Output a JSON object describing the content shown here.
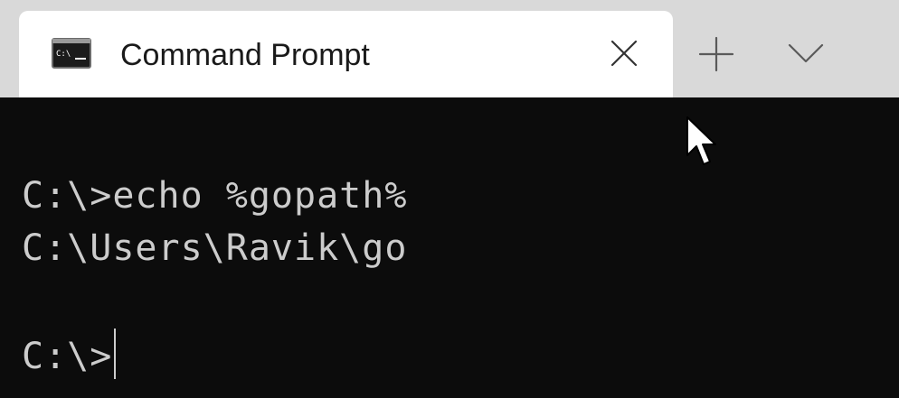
{
  "tab": {
    "title": "Command Prompt",
    "icon": "cmd-icon",
    "close_icon": "close-icon"
  },
  "toolbar": {
    "new_tab_icon": "plus-icon",
    "dropdown_icon": "chevron-down-icon"
  },
  "terminal": {
    "lines": [
      "C:\\>echo %gopath%",
      "C:\\Users\\Ravik\\go",
      "C:\\>"
    ]
  },
  "colors": {
    "terminal_background": "#0c0c0c",
    "terminal_text": "#cccccc",
    "tabbar_background": "#d9d9d9",
    "active_tab_background": "#ffffff"
  }
}
